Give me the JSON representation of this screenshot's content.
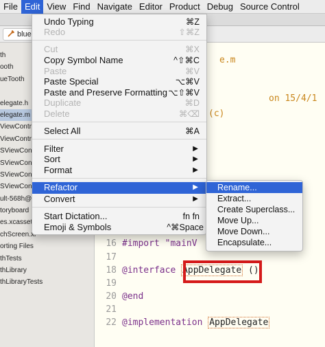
{
  "menubar": {
    "items": [
      {
        "label": "File"
      },
      {
        "label": "Edit"
      },
      {
        "label": "View"
      },
      {
        "label": "Find"
      },
      {
        "label": "Navigate"
      },
      {
        "label": "Editor"
      },
      {
        "label": "Product"
      },
      {
        "label": "Debug"
      },
      {
        "label": "Source Control"
      }
    ]
  },
  "jumpbar": {
    "chip_label": "blueT"
  },
  "navigator": {
    "items": [
      {
        "label": "th"
      },
      {
        "label": "ooth"
      },
      {
        "label": "ueTooth"
      },
      {
        "label": ""
      },
      {
        "label": "elegate.h"
      },
      {
        "label": "elegate.m"
      },
      {
        "label": "ViewContro"
      },
      {
        "label": "ViewContro"
      },
      {
        "label": "SViewContr"
      },
      {
        "label": "SViewContr"
      },
      {
        "label": "SViewContr"
      },
      {
        "label": "SViewContr"
      },
      {
        "label": "ult-568h@"
      },
      {
        "label": "toryboard"
      },
      {
        "label": "es.xcassets"
      },
      {
        "label": "chScreen.xi"
      },
      {
        "label": "orting Files"
      },
      {
        "label": "thTests"
      },
      {
        "label": "thLibrary"
      },
      {
        "label": "thLibraryTests"
      }
    ]
  },
  "editor": {
    "comment_fragments": {
      "file_ext": "e.m",
      "created": "on 15/4/1",
      "copyright": "(c)"
    },
    "lines": [
      {
        "num": "16",
        "text": "#import \"mainV"
      },
      {
        "num": "17",
        "text": ""
      },
      {
        "num": "18",
        "prefix": "@interface ",
        "token": "AppDelegate",
        "suffix": " ()"
      },
      {
        "num": "19",
        "text": ""
      },
      {
        "num": "20",
        "text": "@end"
      },
      {
        "num": "21",
        "text": ""
      },
      {
        "num": "22",
        "prefix": "@implementation ",
        "token": "AppDelegate",
        "suffix": ""
      }
    ]
  },
  "edit_menu": {
    "items": [
      {
        "label": "Undo Typing",
        "shortcut": "⌘Z",
        "enabled": true
      },
      {
        "label": "Redo",
        "shortcut": "⇧⌘Z",
        "enabled": false
      },
      {
        "label": "Cut",
        "shortcut": "⌘X",
        "enabled": false
      },
      {
        "label": "Copy Symbol Name",
        "shortcut": "^⇧⌘C",
        "enabled": true
      },
      {
        "label": "Paste",
        "shortcut": "⌘V",
        "enabled": false
      },
      {
        "label": "Paste Special",
        "shortcut": "⌥⌘V",
        "enabled": true
      },
      {
        "label": "Paste and Preserve Formatting",
        "shortcut": "⌥⇧⌘V",
        "enabled": true
      },
      {
        "label": "Duplicate",
        "shortcut": "⌘D",
        "enabled": false
      },
      {
        "label": "Delete",
        "shortcut": "⌘⌫",
        "enabled": false
      },
      {
        "label": "Select All",
        "shortcut": "⌘A",
        "enabled": true
      },
      {
        "label": "Filter",
        "enabled": true
      },
      {
        "label": "Sort",
        "enabled": true
      },
      {
        "label": "Format",
        "enabled": true
      },
      {
        "label": "Refactor",
        "enabled": true
      },
      {
        "label": "Convert",
        "enabled": true
      },
      {
        "label": "Start Dictation...",
        "shortcut": "fn fn",
        "enabled": true
      },
      {
        "label": "Emoji & Symbols",
        "shortcut": "^⌘Space",
        "enabled": true
      }
    ]
  },
  "refactor_submenu": {
    "items": [
      {
        "label": "Rename..."
      },
      {
        "label": "Extract..."
      },
      {
        "label": "Create Superclass..."
      },
      {
        "label": "Move Up..."
      },
      {
        "label": "Move Down..."
      },
      {
        "label": "Encapsulate..."
      }
    ]
  },
  "colors": {
    "accent": "#2f64d6",
    "callout_box": "#d51a1a",
    "editor_background": "#fffef3",
    "comment": "#c9861b",
    "keyword": "#7a2f8a",
    "string": "#c4302b"
  }
}
